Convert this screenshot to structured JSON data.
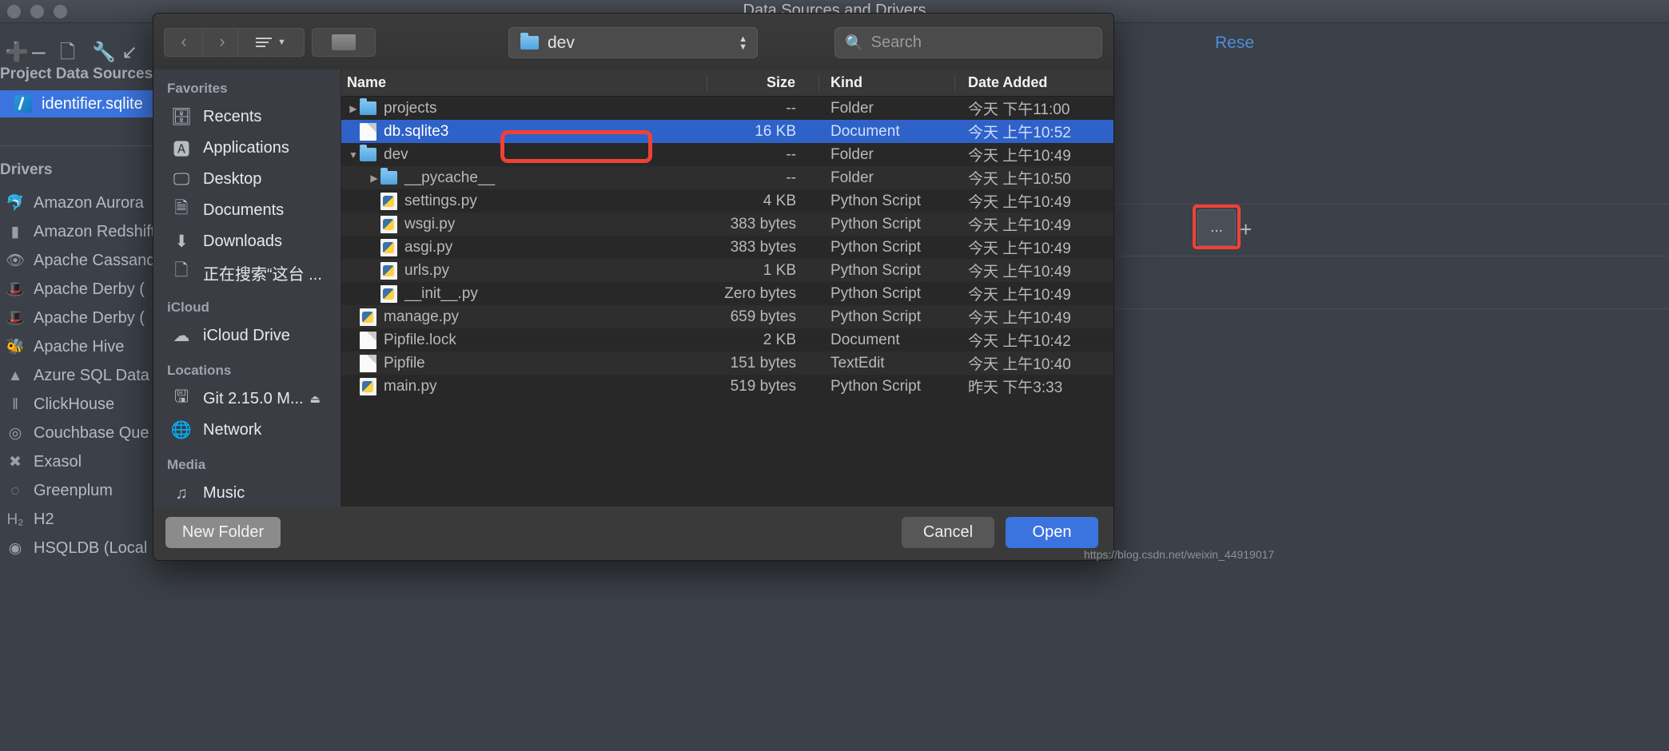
{
  "ide": {
    "window_title": "Data Sources and Drivers",
    "toolbar_icons": [
      "add-icon",
      "remove-icon",
      "copy-icon",
      "wrench-icon",
      "import-icon"
    ],
    "project_sources_label": "Project Data Sources",
    "selected_data_source": "identifier.sqlite",
    "drivers_label": "Drivers",
    "drivers": [
      {
        "label": "Amazon Aurora",
        "icon": "dolphin-icon"
      },
      {
        "label": "Amazon Redshift",
        "icon": "redshift-icon"
      },
      {
        "label": "Apache Cassandra",
        "icon": "eye-icon"
      },
      {
        "label": "Apache Derby (",
        "icon": "hat-icon"
      },
      {
        "label": "Apache Derby (",
        "icon": "hat-icon"
      },
      {
        "label": "Apache Hive",
        "icon": "bee-icon"
      },
      {
        "label": "Azure SQL Data",
        "icon": "azure-icon"
      },
      {
        "label": "ClickHouse",
        "icon": "clickhouse-icon"
      },
      {
        "label": "Couchbase Que",
        "icon": "couchbase-icon"
      },
      {
        "label": "Exasol",
        "icon": "exasol-icon"
      },
      {
        "label": "Greenplum",
        "icon": "greenplum-icon"
      },
      {
        "label": "H2",
        "icon": "h2-icon"
      },
      {
        "label": "HSQLDB (Local",
        "icon": "hsqldb-icon"
      }
    ],
    "reset_link": "Rese",
    "ellipsis_button": "...",
    "add_button": "+"
  },
  "dialog": {
    "toolbar": {
      "back": "‹",
      "forward": "›",
      "view_label": "",
      "new_folder_icon": "new-folder-icon",
      "path_value": "dev",
      "search_placeholder": "Search"
    },
    "sidebar": {
      "groups": [
        {
          "title": "Favorites",
          "items": [
            {
              "label": "Recents",
              "icon": "recents-icon"
            },
            {
              "label": "Applications",
              "icon": "applications-icon"
            },
            {
              "label": "Desktop",
              "icon": "desktop-icon"
            },
            {
              "label": "Documents",
              "icon": "documents-icon"
            },
            {
              "label": "Downloads",
              "icon": "downloads-icon"
            },
            {
              "label": "正在搜索“这台 ...",
              "icon": "search-folder-icon"
            }
          ]
        },
        {
          "title": "iCloud",
          "items": [
            {
              "label": "iCloud Drive",
              "icon": "cloud-icon"
            }
          ]
        },
        {
          "title": "Locations",
          "items": [
            {
              "label": "Git 2.15.0 M...",
              "icon": "drive-icon",
              "eject": "⏏"
            },
            {
              "label": "Network",
              "icon": "network-icon"
            }
          ]
        },
        {
          "title": "Media",
          "items": [
            {
              "label": "Music",
              "icon": "music-icon"
            }
          ]
        }
      ]
    },
    "columns": [
      "Name",
      "Size",
      "Kind",
      "Date Added"
    ],
    "rows": [
      {
        "name": "projects",
        "indent": 0,
        "disclosure": "▶",
        "icon": "folder-icon",
        "size": "--",
        "kind": "Folder",
        "date": "今天 下午11:00",
        "selected": false
      },
      {
        "name": "db.sqlite3",
        "indent": 0,
        "disclosure": "",
        "icon": "document-icon",
        "size": "16 KB",
        "kind": "Document",
        "date": "今天 上午10:52",
        "selected": true
      },
      {
        "name": "dev",
        "indent": 0,
        "disclosure": "▼",
        "icon": "folder-icon",
        "size": "--",
        "kind": "Folder",
        "date": "今天 上午10:49",
        "selected": false
      },
      {
        "name": "__pycache__",
        "indent": 1,
        "disclosure": "▶",
        "icon": "folder-icon",
        "size": "--",
        "kind": "Folder",
        "date": "今天 上午10:50",
        "selected": false
      },
      {
        "name": "settings.py",
        "indent": 1,
        "disclosure": "",
        "icon": "python-icon",
        "size": "4 KB",
        "kind": "Python Script",
        "date": "今天 上午10:49",
        "selected": false
      },
      {
        "name": "wsgi.py",
        "indent": 1,
        "disclosure": "",
        "icon": "python-icon",
        "size": "383 bytes",
        "kind": "Python Script",
        "date": "今天 上午10:49",
        "selected": false
      },
      {
        "name": "asgi.py",
        "indent": 1,
        "disclosure": "",
        "icon": "python-icon",
        "size": "383 bytes",
        "kind": "Python Script",
        "date": "今天 上午10:49",
        "selected": false
      },
      {
        "name": "urls.py",
        "indent": 1,
        "disclosure": "",
        "icon": "python-icon",
        "size": "1 KB",
        "kind": "Python Script",
        "date": "今天 上午10:49",
        "selected": false
      },
      {
        "name": "__init__.py",
        "indent": 1,
        "disclosure": "",
        "icon": "python-icon",
        "size": "Zero bytes",
        "kind": "Python Script",
        "date": "今天 上午10:49",
        "selected": false
      },
      {
        "name": "manage.py",
        "indent": 0,
        "disclosure": "",
        "icon": "python-icon",
        "size": "659 bytes",
        "kind": "Python Script",
        "date": "今天 上午10:49",
        "selected": false
      },
      {
        "name": "Pipfile.lock",
        "indent": 0,
        "disclosure": "",
        "icon": "document-icon",
        "size": "2 KB",
        "kind": "Document",
        "date": "今天 上午10:42",
        "selected": false
      },
      {
        "name": "Pipfile",
        "indent": 0,
        "disclosure": "",
        "icon": "document-icon",
        "size": "151 bytes",
        "kind": "TextEdit",
        "date": "今天 上午10:40",
        "selected": false
      },
      {
        "name": "main.py",
        "indent": 0,
        "disclosure": "",
        "icon": "python-icon",
        "size": "519 bytes",
        "kind": "Python Script",
        "date": "昨天 下午3:33",
        "selected": false
      }
    ],
    "buttons": {
      "new_folder": "New Folder",
      "cancel": "Cancel",
      "open": "Open"
    }
  },
  "watermark": "https://blog.csdn.net/weixin_44919017",
  "colors": {
    "accent_blue": "#3b74de",
    "selection_blue": "#2f62c8",
    "annotation_red": "#ef4136",
    "ide_bg": "#3c4048",
    "dialog_bg": "#2a2a2a"
  }
}
